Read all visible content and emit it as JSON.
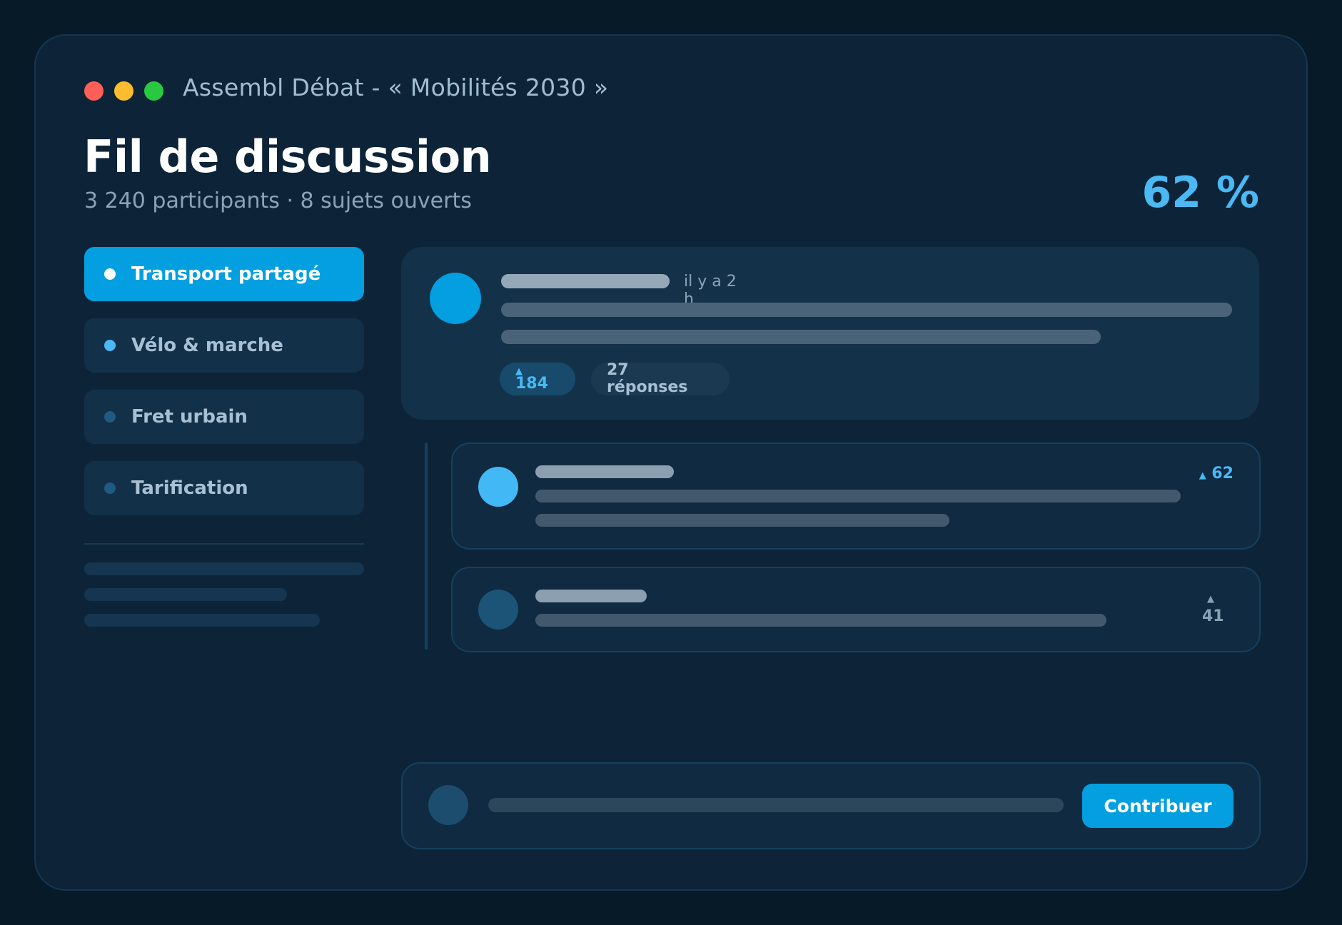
{
  "window": {
    "title": "Assembl Débat - « Mobilités 2030 »",
    "controls": [
      {
        "name": "close",
        "color": "#ff5f57"
      },
      {
        "name": "minimize",
        "color": "#febc2e"
      },
      {
        "name": "maximize",
        "color": "#28c840"
      }
    ]
  },
  "header": {
    "title": "Fil de discussion",
    "subtitle": "3 240 participants · 8 sujets ouverts",
    "stat": "62 %"
  },
  "sidebar": {
    "topics": [
      {
        "label": "Transport partagé",
        "active": true,
        "bullet_color": "#ffffff"
      },
      {
        "label": "Vélo & marche",
        "active": false,
        "bullet_color": "#4ab9f4"
      },
      {
        "label": "Fret urbain",
        "active": false,
        "bullet_color": "#1f5b80"
      },
      {
        "label": "Tarification",
        "active": false,
        "bullet_color": "#1f5b80"
      }
    ]
  },
  "post": {
    "timestamp": "il y a 2 h",
    "upvote_icon": "▲",
    "upvotes": "184",
    "replies": "27 réponses"
  },
  "replies": [
    {
      "vote_icon": "▲",
      "votes": "62",
      "avatar_color": "#42b8f5",
      "vote_color": "#4ab9f4"
    },
    {
      "vote_icon": "▲",
      "votes": "41",
      "avatar_color": "#1c5478",
      "vote_color": "#8aa2b5"
    }
  ],
  "compose": {
    "button_label": "Contribuer"
  },
  "colors": {
    "accent": "#039fe0",
    "accent_light": "#4ab9f4",
    "background": "#0d2438"
  }
}
